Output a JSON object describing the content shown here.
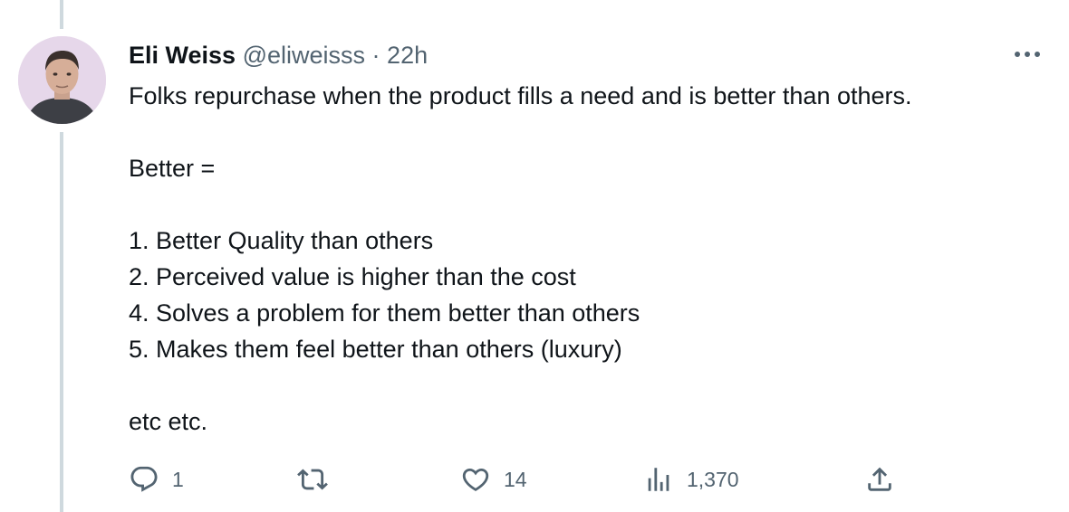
{
  "tweet": {
    "author_name": "Eli Weiss",
    "handle": "@eliweisss",
    "separator": "·",
    "time": "22h",
    "lines": [
      "Folks repurchase when the product fills a need and is better than others.",
      "",
      "Better =",
      "",
      "1. Better Quality than others",
      "2. Perceived value is higher than the cost",
      "4. Solves a problem for them better than others",
      "5. Makes them feel better than others (luxury)",
      "",
      "etc etc."
    ]
  },
  "actions": {
    "reply_count": "1",
    "retweet_count": "",
    "like_count": "14",
    "views_count": "1,370"
  },
  "icons": {
    "reply": "reply-icon",
    "retweet": "retweet-icon",
    "like": "heart-icon",
    "views": "views-icon",
    "share": "share-icon",
    "more": "more-icon"
  },
  "colors": {
    "text": "#0f1419",
    "secondary": "#536471",
    "thread_line": "#cfd9de"
  }
}
